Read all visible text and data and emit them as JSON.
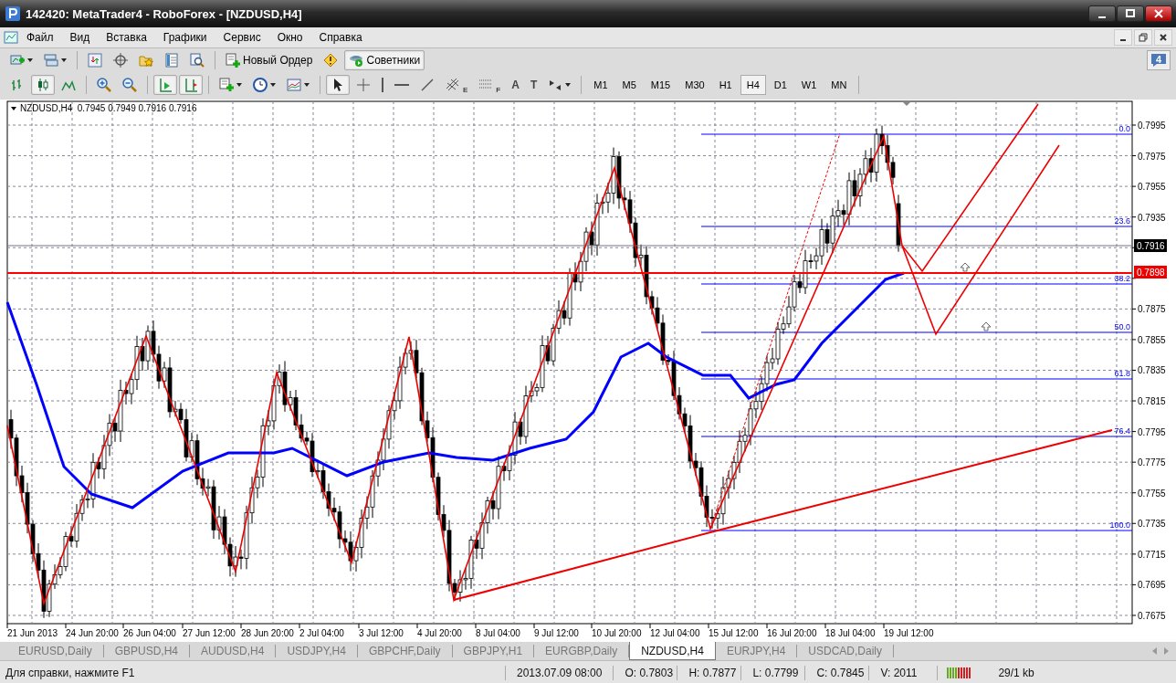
{
  "window": {
    "title": "142420: MetaTrader4 - RoboForex - [NZDUSD,H4]"
  },
  "menu": [
    "Файл",
    "Вид",
    "Вставка",
    "Графики",
    "Сервис",
    "Окно",
    "Справка"
  ],
  "toolbar": {
    "buttons": [
      {
        "label": "Новый Ордер",
        "pressed": false
      },
      {
        "label": "Советники",
        "pressed": true
      }
    ],
    "notification_count": "4"
  },
  "chart_toolbar": [
    {
      "pressed": false
    },
    {
      "pressed": true
    },
    {
      "pressed": false
    },
    {
      "pressed": false
    },
    {
      "pressed": false
    },
    {
      "pressed": true
    },
    {
      "pressed": true
    },
    {
      "pressed": false
    },
    {
      "pressed": false
    },
    {
      "pressed": false
    },
    {
      "pressed": true
    },
    {
      "pressed": false
    },
    {
      "pressed": false
    },
    {
      "pressed": false
    },
    {
      "pressed": false
    },
    {
      "pressed": false,
      "glyph": "E"
    },
    {
      "pressed": false,
      "glyph": "F"
    },
    {
      "pressed": false,
      "glyph": "A"
    },
    {
      "pressed": false,
      "glyph": "T"
    },
    {
      "pressed": false
    }
  ],
  "periods": [
    {
      "label": "M1",
      "selected": false
    },
    {
      "label": "M5",
      "selected": false
    },
    {
      "label": "M15",
      "selected": false
    },
    {
      "label": "M30",
      "selected": false
    },
    {
      "label": "H1",
      "selected": false
    },
    {
      "label": "H4",
      "selected": true
    },
    {
      "label": "D1",
      "selected": false
    },
    {
      "label": "W1",
      "selected": false
    },
    {
      "label": "MN",
      "selected": false
    }
  ],
  "chart": {
    "header": "NZDUSD,H4  0.7945 0.7949 0.7916 0.7916",
    "price_labels": [
      "0.7995",
      "0.7975",
      "0.7955",
      "0.7935",
      "0.7875",
      "0.7855",
      "0.7835",
      "0.7815",
      "0.7795",
      "0.7775",
      "0.7755",
      "0.7735",
      "0.7715",
      "0.7695",
      "0.7675"
    ],
    "time_labels": [
      "21 Jun 2013",
      "24 Jun 20:00",
      "26 Jun 04:00",
      "27 Jun 12:00",
      "28 Jun 20:00",
      "2 Jul 04:00",
      "3 Jul 12:00",
      "4 Jul 20:00",
      "8 Jul 04:00",
      "9 Jul 12:00",
      "10 Jul 20:00",
      "12 Jul 04:00",
      "15 Jul 12:00",
      "16 Jul 20:00",
      "18 Jul 04:00",
      "19 Jul 12:00"
    ],
    "fib_levels": [
      "0.0",
      "23.6",
      "38.2",
      "50.0",
      "61.8",
      "76.4",
      "100.0"
    ],
    "bid_tag": "0.7916",
    "line_tag": "0.7898"
  },
  "tabs": [
    {
      "label": "EURUSD,Daily",
      "selected": false
    },
    {
      "label": "GBPUSD,H4",
      "selected": false
    },
    {
      "label": "AUDUSD,H4",
      "selected": false
    },
    {
      "label": "USDJPY,H4",
      "selected": false
    },
    {
      "label": "GBPCHF,Daily",
      "selected": false
    },
    {
      "label": "GBPJPY,H1",
      "selected": false
    },
    {
      "label": "EURGBP,Daily",
      "selected": false
    },
    {
      "label": "NZDUSD,H4",
      "selected": true
    },
    {
      "label": "EURJPY,H4",
      "selected": false
    },
    {
      "label": "USDCAD,Daily",
      "selected": false
    }
  ],
  "status_bar": {
    "help": "Для справки, нажмите F1",
    "time": "2013.07.09 08:00",
    "open": "O: 0.7803",
    "high": "H: 0.7877",
    "low": "L: 0.7799",
    "close": "C: 0.7845",
    "volume": "V: 2011",
    "traffic": "29/1 kb"
  }
}
